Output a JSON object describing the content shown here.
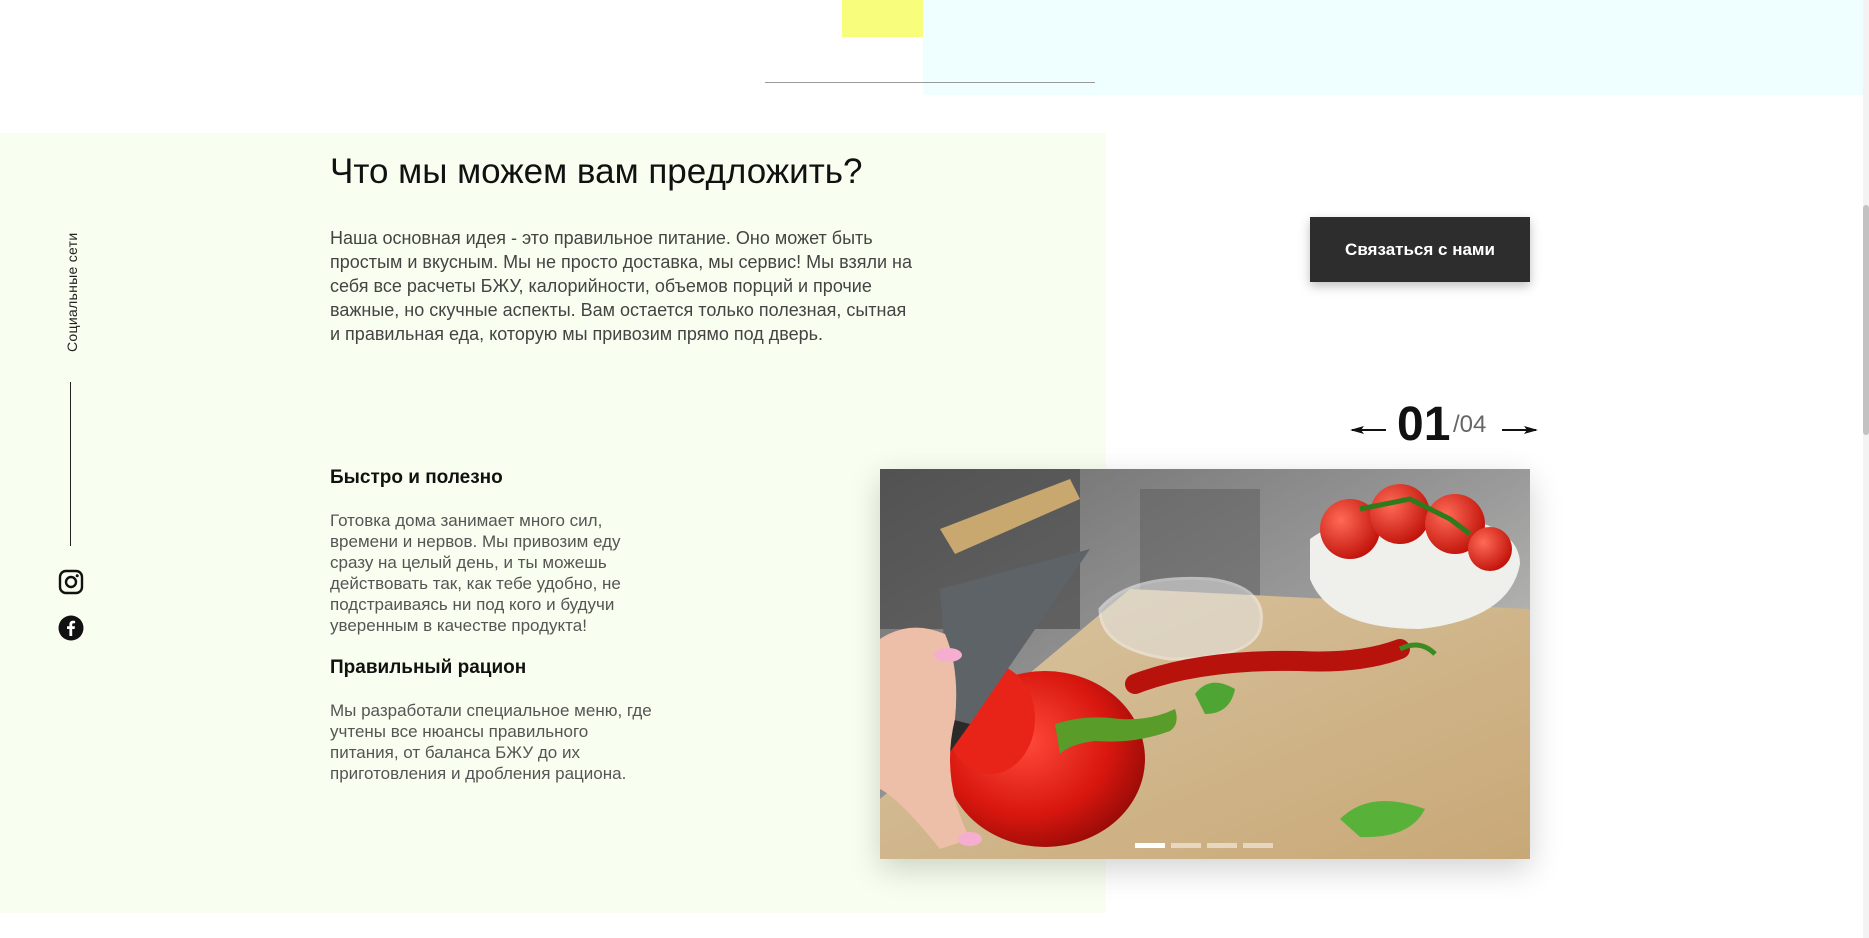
{
  "section": {
    "heading": "Что мы можем вам предложить?",
    "intro": "Наша основная идея - это правильное питание. Оно может быть простым и вкусным. Мы не просто доставка, мы сервис! Мы взяли на себя все расчеты БЖУ, калорийности, объемов порций и прочие важные, но скучные аспекты. Вам остается только полезная, сытная и правильная еда, которую мы привозим прямо под дверь.",
    "features": [
      {
        "title": "Быстро и полезно",
        "text": "Готовка дома занимает много сил, времени и нервов. Мы привозим еду сразу на целый день, и ты можешь действовать так, как тебе удобно, не подстраиваясь ни под кого и будучи уверенным в качестве продукта!"
      },
      {
        "title": "Правильный рацион",
        "text": "Мы разработали специальное меню, где учтены все нюансы правильного питания, от баланса БЖУ до их приготовления и дробления рациона."
      }
    ]
  },
  "social": {
    "caption": "Социальные сети",
    "icons": [
      "instagram-icon",
      "facebook-icon"
    ]
  },
  "contact_button": {
    "label": "Связаться с нами"
  },
  "slider": {
    "current": "01",
    "total": "/04",
    "slide_count": 4,
    "active_index": 0
  },
  "colors": {
    "accent_yellow": "#f9fd7c",
    "accent_cyan": "#effefe",
    "panel_bg": "#f8fff0",
    "button_bg": "#2d2d2d"
  }
}
